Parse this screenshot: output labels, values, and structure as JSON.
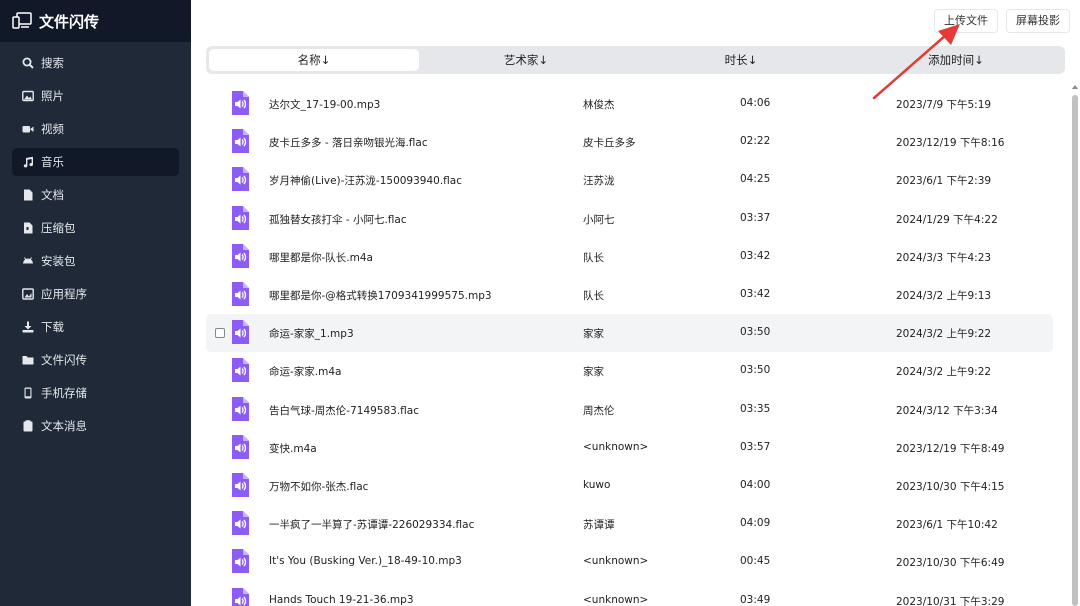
{
  "app": {
    "title": "文件闪传"
  },
  "sidebar": {
    "items": [
      {
        "label": "搜索",
        "icon": "search-icon"
      },
      {
        "label": "照片",
        "icon": "image-icon"
      },
      {
        "label": "视频",
        "icon": "video-icon"
      },
      {
        "label": "音乐",
        "icon": "music-icon",
        "active": true
      },
      {
        "label": "文档",
        "icon": "document-icon"
      },
      {
        "label": "压缩包",
        "icon": "archive-icon"
      },
      {
        "label": "安装包",
        "icon": "android-icon"
      },
      {
        "label": "应用程序",
        "icon": "app-icon"
      },
      {
        "label": "下载",
        "icon": "download-icon"
      },
      {
        "label": "文件闪传",
        "icon": "folder-icon"
      },
      {
        "label": "手机存储",
        "icon": "phone-icon"
      },
      {
        "label": "文本消息",
        "icon": "clipboard-icon"
      }
    ]
  },
  "toolbar": {
    "upload_label": "上传文件",
    "cast_label": "屏幕投影"
  },
  "columns": {
    "name": "名称↓",
    "artist": "艺术家↓",
    "duration": "时长↓",
    "added": "添加时间↓",
    "selected": "name"
  },
  "rows": [
    {
      "name": "达尔文_17-19-00.mp3",
      "artist": "林俊杰",
      "duration": "04:06",
      "added": "2023/7/9 下午5:19"
    },
    {
      "name": "皮卡丘多多 - 落日亲吻银光海.flac",
      "artist": "皮卡丘多多",
      "duration": "02:22",
      "added": "2023/12/19 下午8:16"
    },
    {
      "name": "岁月神偷(Live)-汪苏泷-150093940.flac",
      "artist": "汪苏泷",
      "duration": "04:25",
      "added": "2023/6/1 下午2:39"
    },
    {
      "name": "孤独替女孩打伞 - 小阿七.flac",
      "artist": "小阿七",
      "duration": "03:37",
      "added": "2024/1/29 下午4:22"
    },
    {
      "name": "哪里都是你-队长.m4a",
      "artist": "队长",
      "duration": "03:42",
      "added": "2024/3/3 下午4:23"
    },
    {
      "name": "哪里都是你-@格式转换1709341999575.mp3",
      "artist": "队长",
      "duration": "03:42",
      "added": "2024/3/2 上午9:13"
    },
    {
      "name": "命运-家家_1.mp3",
      "artist": "家家",
      "duration": "03:50",
      "added": "2024/3/2 上午9:22",
      "hover": true
    },
    {
      "name": "命运-家家.m4a",
      "artist": "家家",
      "duration": "03:50",
      "added": "2024/3/2 上午9:22"
    },
    {
      "name": "告白气球-周杰伦-7149583.flac",
      "artist": "周杰伦",
      "duration": "03:35",
      "added": "2024/3/12 下午3:34"
    },
    {
      "name": "变快.m4a",
      "artist": "<unknown>",
      "duration": "03:57",
      "added": "2023/12/19 下午8:49"
    },
    {
      "name": "万物不如你-张杰.flac",
      "artist": "kuwo",
      "duration": "04:00",
      "added": "2023/10/30 下午4:15"
    },
    {
      "name": "一半疯了一半算了-苏谭谭-226029334.flac",
      "artist": "苏谭谭",
      "duration": "04:09",
      "added": "2023/6/1 下午10:42"
    },
    {
      "name": "It's You (Busking Ver.)_18-49-10.mp3",
      "artist": "<unknown>",
      "duration": "00:45",
      "added": "2023/10/30 下午6:49"
    },
    {
      "name": "Hands Touch  19-21-36.mp3",
      "artist": "<unknown>",
      "duration": "03:49",
      "added": "2023/10/31 下午3:29"
    }
  ],
  "colors": {
    "sidebar_bg": "#1f2937",
    "file_icon": "#8b5cf6",
    "arrow": "#e53935"
  }
}
